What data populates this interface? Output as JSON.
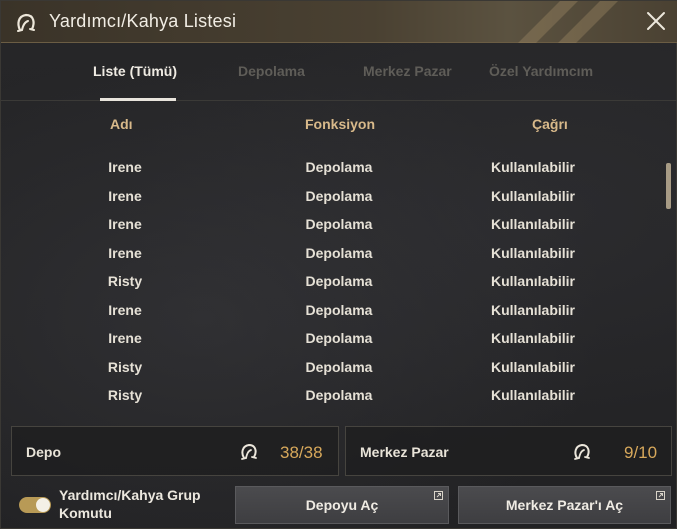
{
  "window": {
    "title": "Yardımcı/Kahya Listesi",
    "close_icon": "close-icon",
    "title_icon": "helper-head-icon"
  },
  "tabs": [
    {
      "label": "Liste (Tümü)",
      "active": true
    },
    {
      "label": "Depolama",
      "active": false
    },
    {
      "label": "Merkez Pazar",
      "active": false
    },
    {
      "label": "Özel Yardımcım",
      "active": false
    }
  ],
  "table": {
    "columns": [
      "Adı",
      "Fonksiyon",
      "Çağrı"
    ],
    "rows": [
      {
        "name": "Irene",
        "function": "Depolama",
        "call": "Kullanılabilir"
      },
      {
        "name": "Irene",
        "function": "Depolama",
        "call": "Kullanılabilir"
      },
      {
        "name": "Irene",
        "function": "Depolama",
        "call": "Kullanılabilir"
      },
      {
        "name": "Irene",
        "function": "Depolama",
        "call": "Kullanılabilir"
      },
      {
        "name": "Risty",
        "function": "Depolama",
        "call": "Kullanılabilir"
      },
      {
        "name": "Irene",
        "function": "Depolama",
        "call": "Kullanılabilir"
      },
      {
        "name": "Irene",
        "function": "Depolama",
        "call": "Kullanılabilir"
      },
      {
        "name": "Risty",
        "function": "Depolama",
        "call": "Kullanılabilir"
      },
      {
        "name": "Risty",
        "function": "Depolama",
        "call": "Kullanılabilir"
      }
    ]
  },
  "panels": {
    "depo": {
      "label": "Depo",
      "value": "38/38",
      "icon": "helper-head-icon"
    },
    "merkez": {
      "label": "Merkez Pazar",
      "value": "9/10",
      "icon": "helper-head-icon"
    }
  },
  "footer": {
    "toggle_label": "Yardımcı/Kahya Grup Komutu",
    "toggle_on": true,
    "open_storage_button": "Depoyu Aç",
    "open_market_button": "Merkez Pazar'ı Aç"
  },
  "colors": {
    "accent_gold": "#d7a85b",
    "header_text": "#d8b98a",
    "title_bar": "#4a4132"
  }
}
